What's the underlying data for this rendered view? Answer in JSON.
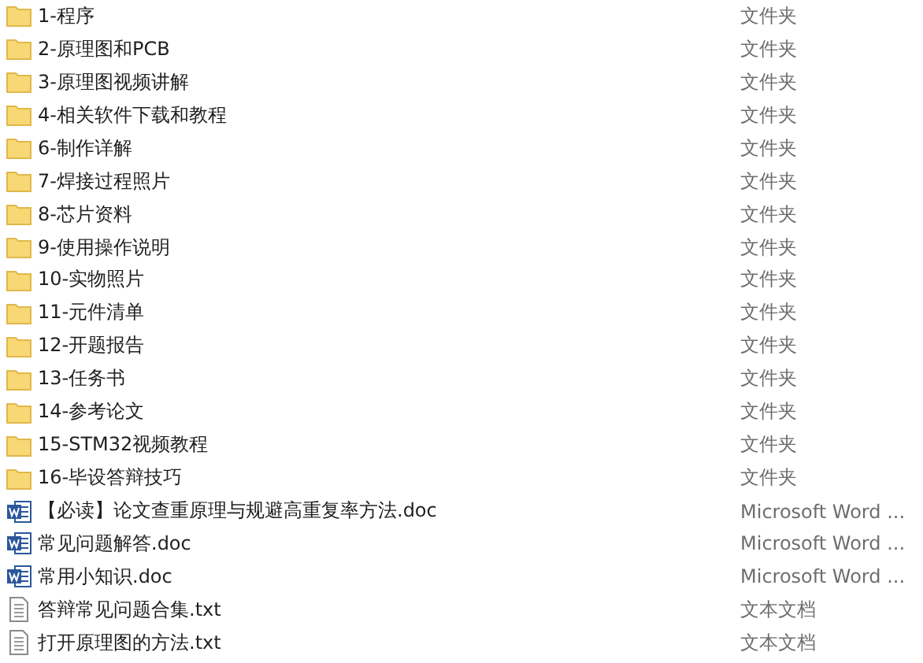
{
  "files": [
    {
      "name": "1-程序",
      "type": "文件夹",
      "kind": "folder"
    },
    {
      "name": "2-原理图和PCB",
      "type": "文件夹",
      "kind": "folder"
    },
    {
      "name": "3-原理图视频讲解",
      "type": "文件夹",
      "kind": "folder"
    },
    {
      "name": "4-相关软件下载和教程",
      "type": "文件夹",
      "kind": "folder"
    },
    {
      "name": "6-制作详解",
      "type": "文件夹",
      "kind": "folder"
    },
    {
      "name": "7-焊接过程照片",
      "type": "文件夹",
      "kind": "folder"
    },
    {
      "name": "8-芯片资料",
      "type": "文件夹",
      "kind": "folder"
    },
    {
      "name": "9-使用操作说明",
      "type": "文件夹",
      "kind": "folder"
    },
    {
      "name": "10-实物照片",
      "type": "文件夹",
      "kind": "folder"
    },
    {
      "name": "11-元件清单",
      "type": "文件夹",
      "kind": "folder"
    },
    {
      "name": "12-开题报告",
      "type": "文件夹",
      "kind": "folder"
    },
    {
      "name": "13-任务书",
      "type": "文件夹",
      "kind": "folder"
    },
    {
      "name": "14-参考论文",
      "type": "文件夹",
      "kind": "folder"
    },
    {
      "name": "15-STM32视频教程",
      "type": "文件夹",
      "kind": "folder"
    },
    {
      "name": "16-毕设答辩技巧",
      "type": "文件夹",
      "kind": "folder"
    },
    {
      "name": "【必读】论文查重原理与规避高重复率方法.doc",
      "type": "Microsoft Word ...",
      "kind": "word"
    },
    {
      "name": "常见问题解答.doc",
      "type": "Microsoft Word ...",
      "kind": "word"
    },
    {
      "name": "常用小知识.doc",
      "type": "Microsoft Word ...",
      "kind": "word"
    },
    {
      "name": "答辩常见问题合集.txt",
      "type": "文本文档",
      "kind": "text"
    },
    {
      "name": "打开原理图的方法.txt",
      "type": "文本文档",
      "kind": "text"
    }
  ]
}
